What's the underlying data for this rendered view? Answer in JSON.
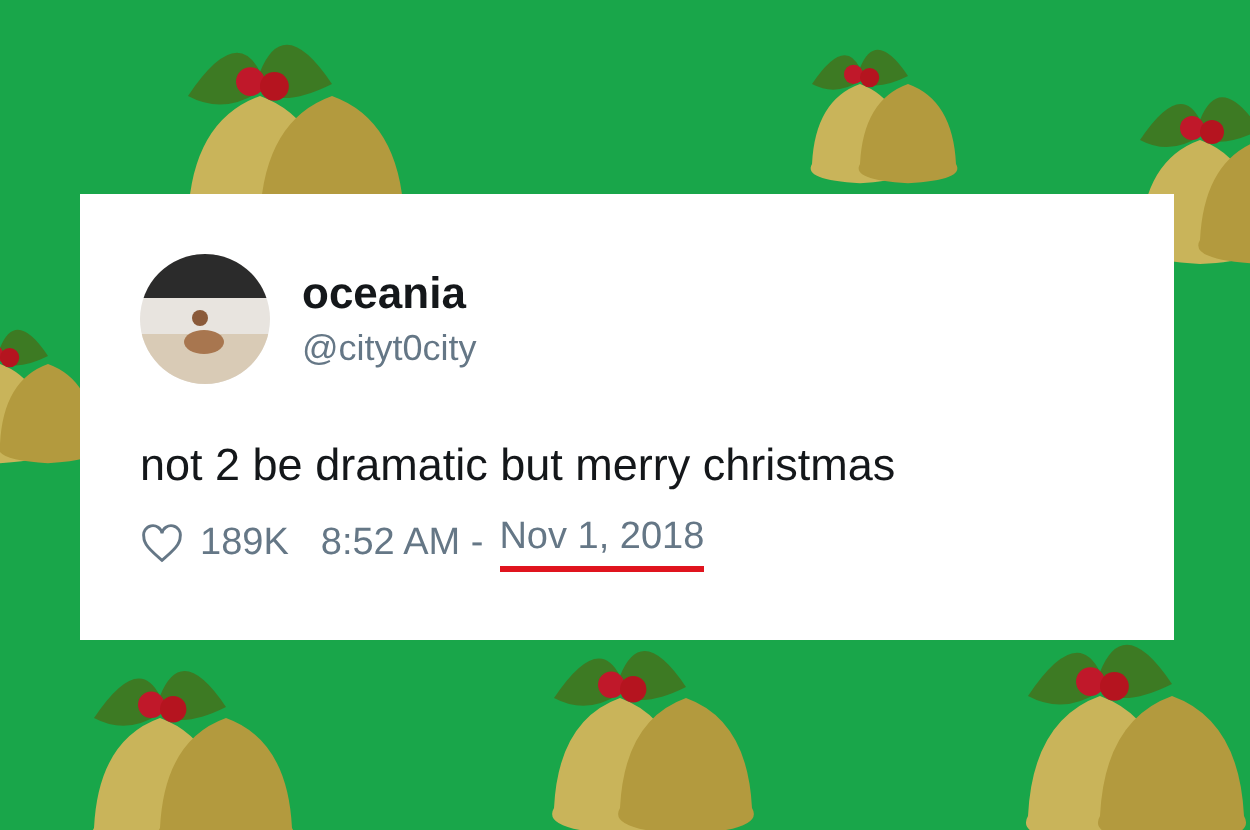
{
  "tweet": {
    "name": "oceania",
    "handle": "@cityt0city",
    "text": "not 2 be dramatic but merry christmas",
    "likes": "189K",
    "time": "8:52 AM -",
    "date": "Nov 1, 2018",
    "date_underlined": true
  }
}
